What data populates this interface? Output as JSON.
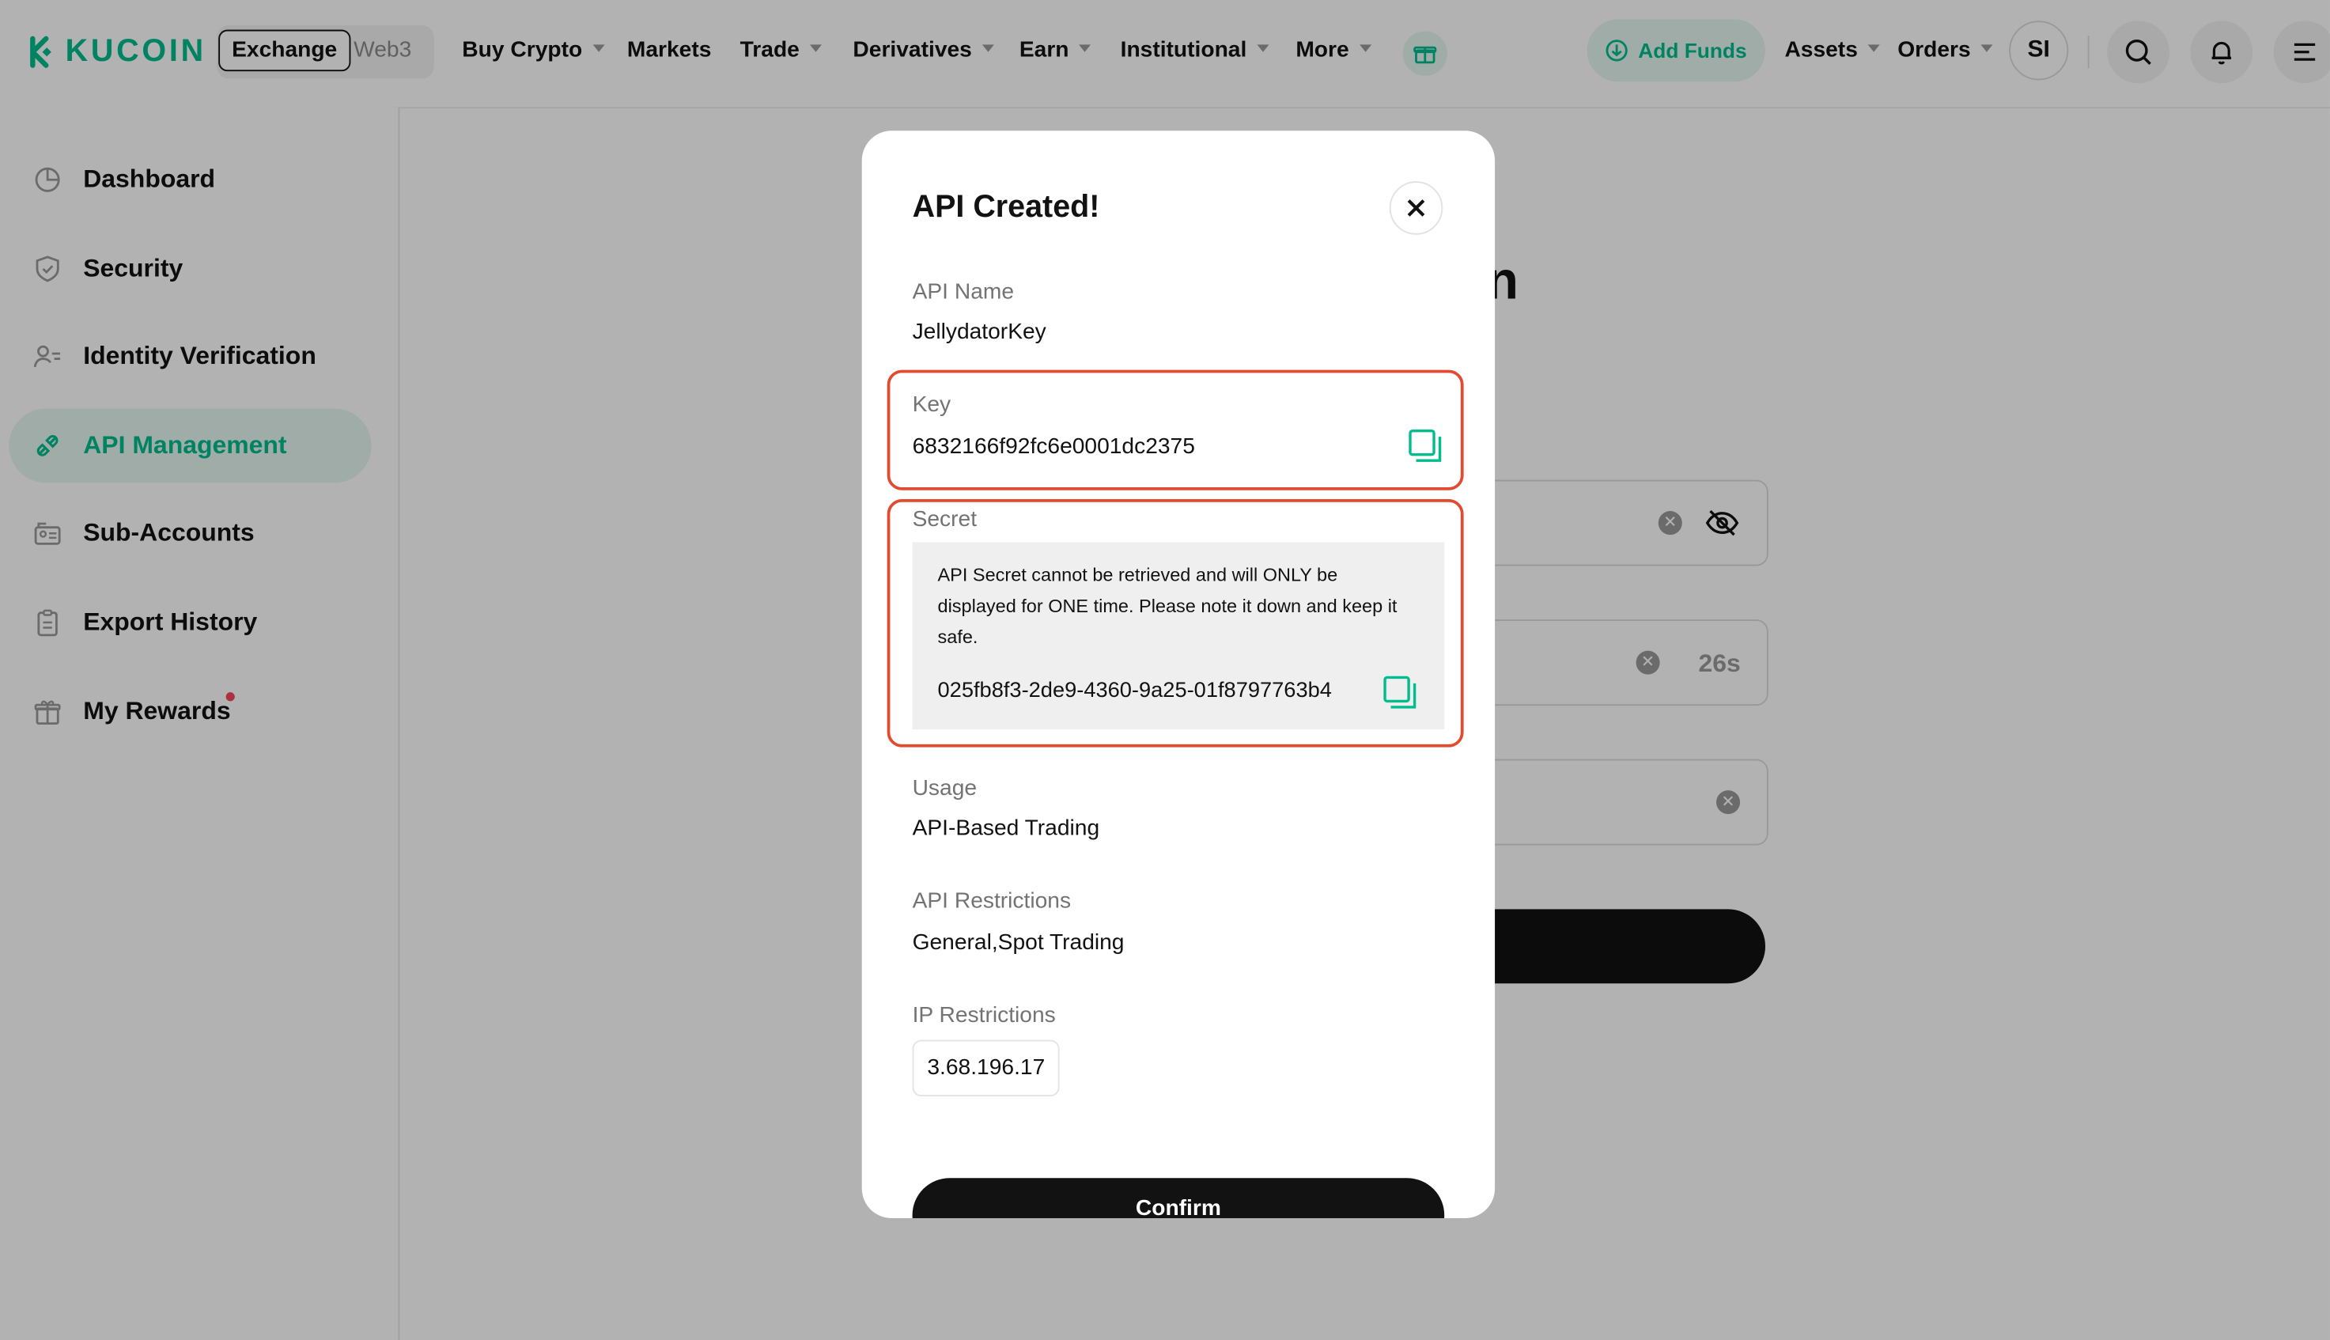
{
  "nav": {
    "logo": "KUCOIN",
    "exchange": "Exchange",
    "web3": "Web3",
    "items": [
      {
        "label": "Buy Crypto",
        "caret": true
      },
      {
        "label": "Markets",
        "caret": false
      },
      {
        "label": "Trade",
        "caret": true
      },
      {
        "label": "Derivatives",
        "caret": true
      },
      {
        "label": "Earn",
        "caret": true
      },
      {
        "label": "Institutional",
        "caret": true
      },
      {
        "label": "More",
        "caret": true
      }
    ],
    "add_funds": "Add Funds",
    "assets": "Assets",
    "orders": "Orders",
    "avatar": "SI",
    "icons": [
      "gift-icon",
      "download-icon",
      "search-icon",
      "bell-icon",
      "menu-icon"
    ]
  },
  "sidebar": {
    "items": [
      {
        "label": "Dashboard",
        "icon": "pie-chart-icon"
      },
      {
        "label": "Security",
        "icon": "shield-icon"
      },
      {
        "label": "Identity Verification",
        "icon": "user-id-icon"
      },
      {
        "label": "API Management",
        "icon": "api-link-icon",
        "active": true
      },
      {
        "label": "Sub-Accounts",
        "icon": "sub-accounts-icon"
      },
      {
        "label": "Export History",
        "icon": "clipboard-icon"
      },
      {
        "label": "My Rewards",
        "icon": "gift-icon",
        "badge": true
      }
    ]
  },
  "background": {
    "title_fragment": "n",
    "countdown": "26s"
  },
  "modal": {
    "title": "API Created!",
    "api_name_label": "API Name",
    "api_name_value": "JellydatorKey",
    "key_label": "Key",
    "key_value": "6832166f92fc6e0001dc2375",
    "secret_label": "Secret",
    "secret_warning": "API Secret cannot be retrieved and will ONLY be displayed for ONE time. Please note it down and keep it safe.",
    "secret_value": "025fb8f3-2de9-4360-9a25-01f8797763b4",
    "usage_label": "Usage",
    "usage_value": "API-Based Trading",
    "restrictions_label": "API Restrictions",
    "restrictions_value": "General,Spot Trading",
    "ip_label": "IP Restrictions",
    "ip_value": "3.68.196.17",
    "confirm": "Confirm"
  },
  "colors": {
    "accent": "#01bc8d",
    "accent_soft": "#e6f7f1",
    "highlight_border": "#e24b2f",
    "dark": "#121212",
    "overlay": "rgba(0,0,0,0.30)"
  }
}
